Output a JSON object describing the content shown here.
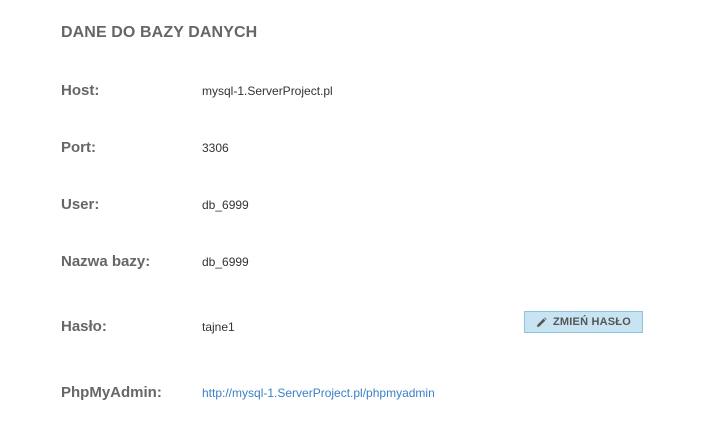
{
  "panel": {
    "title": "DANE DO BAZY DANYCH"
  },
  "fields": {
    "host": {
      "label": "Host:",
      "value": "mysql-1.ServerProject.pl"
    },
    "port": {
      "label": "Port:",
      "value": "3306"
    },
    "user": {
      "label": "User:",
      "value": "db_6999"
    },
    "dbname": {
      "label": "Nazwa bazy:",
      "value": "db_6999"
    },
    "password": {
      "label": "Hasło:",
      "value": "tajne1"
    },
    "phpmyadmin": {
      "label": "PhpMyAdmin:",
      "value": "http://mysql-1.ServerProject.pl/phpmyadmin"
    }
  },
  "actions": {
    "change_password_label": "ZMIEŃ HASŁO",
    "change_password_icon": "pencil-icon"
  },
  "colors": {
    "link": "#3a7fc7",
    "button_bg": "#c8e4f3",
    "button_border": "#8ec3de"
  }
}
